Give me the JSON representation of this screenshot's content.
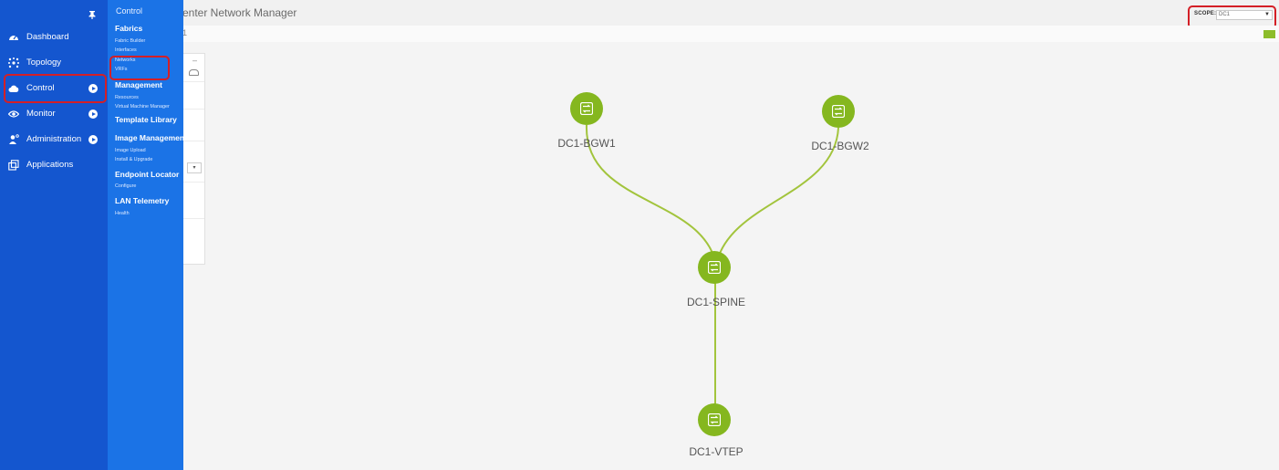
{
  "header": {
    "app_title": "enter Network Manager",
    "breadcrumb": "1"
  },
  "scope": {
    "label": "SCOPE:",
    "value": "DC1"
  },
  "sidebar": {
    "items": [
      {
        "label": "Dashboard",
        "icon": "dashboard-icon"
      },
      {
        "label": "Topology",
        "icon": "topology-icon"
      },
      {
        "label": "Control",
        "icon": "cloud-icon",
        "active": true
      },
      {
        "label": "Monitor",
        "icon": "eye-icon"
      },
      {
        "label": "Administration",
        "icon": "admin-icon"
      },
      {
        "label": "Applications",
        "icon": "applications-icon"
      }
    ]
  },
  "flyout": {
    "title": "Control",
    "fabrics": {
      "header": "Fabrics",
      "items": [
        "Fabric Builder",
        "Interfaces",
        "Networks",
        "VRFs"
      ]
    },
    "management": {
      "header": "Management",
      "items": [
        "Resources",
        "Virtual Machine Manager"
      ]
    },
    "template_library": {
      "header": "Template Library"
    },
    "image_management": {
      "header": "Image Management",
      "items": [
        "Image Upload",
        "Install & Upgrade"
      ]
    },
    "endpoint_locator": {
      "header": "Endpoint Locator",
      "items": [
        "Configure"
      ]
    },
    "lan_telemetry": {
      "header": "LAN Telemetry",
      "items": [
        "Health"
      ]
    }
  },
  "topology": {
    "nodes": [
      {
        "id": "bgw1",
        "label": "DC1-BGW1"
      },
      {
        "id": "bgw2",
        "label": "DC1-BGW2"
      },
      {
        "id": "spine",
        "label": "DC1-SPINE"
      },
      {
        "id": "vtep",
        "label": "DC1-VTEP"
      }
    ],
    "links": [
      [
        "bgw1",
        "spine"
      ],
      [
        "bgw2",
        "spine"
      ],
      [
        "spine",
        "vtep"
      ]
    ]
  },
  "colors": {
    "sidebar": "#1456cf",
    "flyout": "#1b73e6",
    "node": "#85b71f",
    "link": "#a2c43c",
    "highlight": "#d41f26"
  }
}
